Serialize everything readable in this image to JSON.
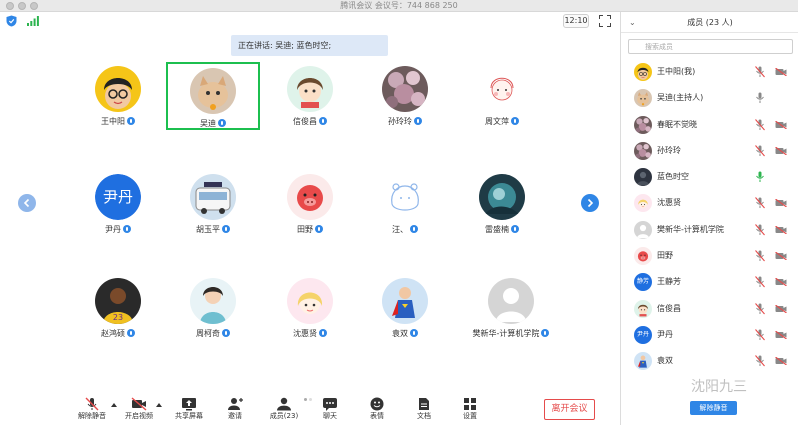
{
  "window": {
    "title": "腾讯会议 会议号：744 868 250"
  },
  "topbar": {
    "clock": "12:10"
  },
  "speaking": {
    "label": "正在讲话: 吴迪; 蓝色时空;"
  },
  "grid": {
    "tiles": [
      {
        "name": "王中阳",
        "avatar": "cartoon-glasses",
        "active": false
      },
      {
        "name": "吴迪",
        "avatar": "cat-photo",
        "active": true
      },
      {
        "name": "信俊昌",
        "avatar": "cartoon-girl",
        "active": false
      },
      {
        "name": "孙玲玲",
        "avatar": "flowers-photo",
        "active": false
      },
      {
        "name": "周文萍",
        "avatar": "sketch-girl",
        "active": false
      },
      {
        "name": "尹丹",
        "avatar": "text",
        "avatar_text": "尹丹",
        "active": false
      },
      {
        "name": "胡玉平",
        "avatar": "bus-photo",
        "active": false
      },
      {
        "name": "田野",
        "avatar": "red-pig",
        "active": false
      },
      {
        "name": "汪、",
        "avatar": "line-bear",
        "active": false
      },
      {
        "name": "雷盛楠",
        "avatar": "teal-photo",
        "active": false
      },
      {
        "name": "赵鸿硕",
        "avatar": "basketball-player",
        "active": false
      },
      {
        "name": "周柯奇",
        "avatar": "girl-photo",
        "active": false
      },
      {
        "name": "沈惠贤",
        "avatar": "cartoon-blonde",
        "active": false
      },
      {
        "name": "袁双",
        "avatar": "superman-photo",
        "active": false
      },
      {
        "name": "樊新华-计算机学院",
        "avatar": "default-person",
        "active": false
      }
    ]
  },
  "toolbar": {
    "items": [
      {
        "label": "解除静音",
        "icon": "mic-muted-icon"
      },
      {
        "label": "开启视频",
        "icon": "camera-off-icon"
      },
      {
        "label": "共享屏幕",
        "icon": "share-screen-icon"
      },
      {
        "label": "邀请",
        "icon": "invite-icon"
      },
      {
        "label": "成员(23)",
        "icon": "members-icon"
      },
      {
        "label": "聊天",
        "icon": "chat-icon"
      },
      {
        "label": "表情",
        "icon": "emoji-icon"
      },
      {
        "label": "文档",
        "icon": "document-icon"
      },
      {
        "label": "设置",
        "icon": "settings-icon"
      }
    ],
    "leave_label": "离开会议"
  },
  "panel": {
    "title": "成员 (23 人)",
    "search_placeholder": "搜索成员",
    "members": [
      {
        "name": "王中阳(我)",
        "avatar": "cartoon-glasses",
        "mic": "muted",
        "video": "off"
      },
      {
        "name": "吴迪(主持人)",
        "avatar": "cat-photo",
        "mic": "on",
        "video": "none"
      },
      {
        "name": "春眠不觉晓",
        "avatar": "flowers-photo",
        "mic": "muted",
        "video": "off"
      },
      {
        "name": "孙玲玲",
        "avatar": "flowers-photo",
        "mic": "muted",
        "video": "off"
      },
      {
        "name": "蓝色时空",
        "avatar": "dark-photo",
        "mic": "speaking",
        "video": "none"
      },
      {
        "name": "沈惠贤",
        "avatar": "cartoon-blonde",
        "mic": "muted",
        "video": "off"
      },
      {
        "name": "樊新华-计算机学院",
        "avatar": "default-person",
        "mic": "muted",
        "video": "off"
      },
      {
        "name": "田野",
        "avatar": "red-pig",
        "mic": "muted",
        "video": "off"
      },
      {
        "name": "王静芳",
        "avatar": "text",
        "avatar_text": "静芳",
        "mic": "muted",
        "video": "off"
      },
      {
        "name": "信俊昌",
        "avatar": "cartoon-girl",
        "mic": "muted",
        "video": "off"
      },
      {
        "name": "尹丹",
        "avatar": "text",
        "avatar_text": "尹丹",
        "mic": "muted",
        "video": "off"
      },
      {
        "name": "袁双",
        "avatar": "superman-photo",
        "mic": "muted",
        "video": "off"
      }
    ],
    "unmute_all_label": "解除静音"
  },
  "watermark": {
    "text": "沈阳九三"
  },
  "colors": {
    "accent": "#2f86e6",
    "leave": "#e54b4b",
    "active_border": "#1cbf4f",
    "speaking_bg": "#dde8f7"
  }
}
